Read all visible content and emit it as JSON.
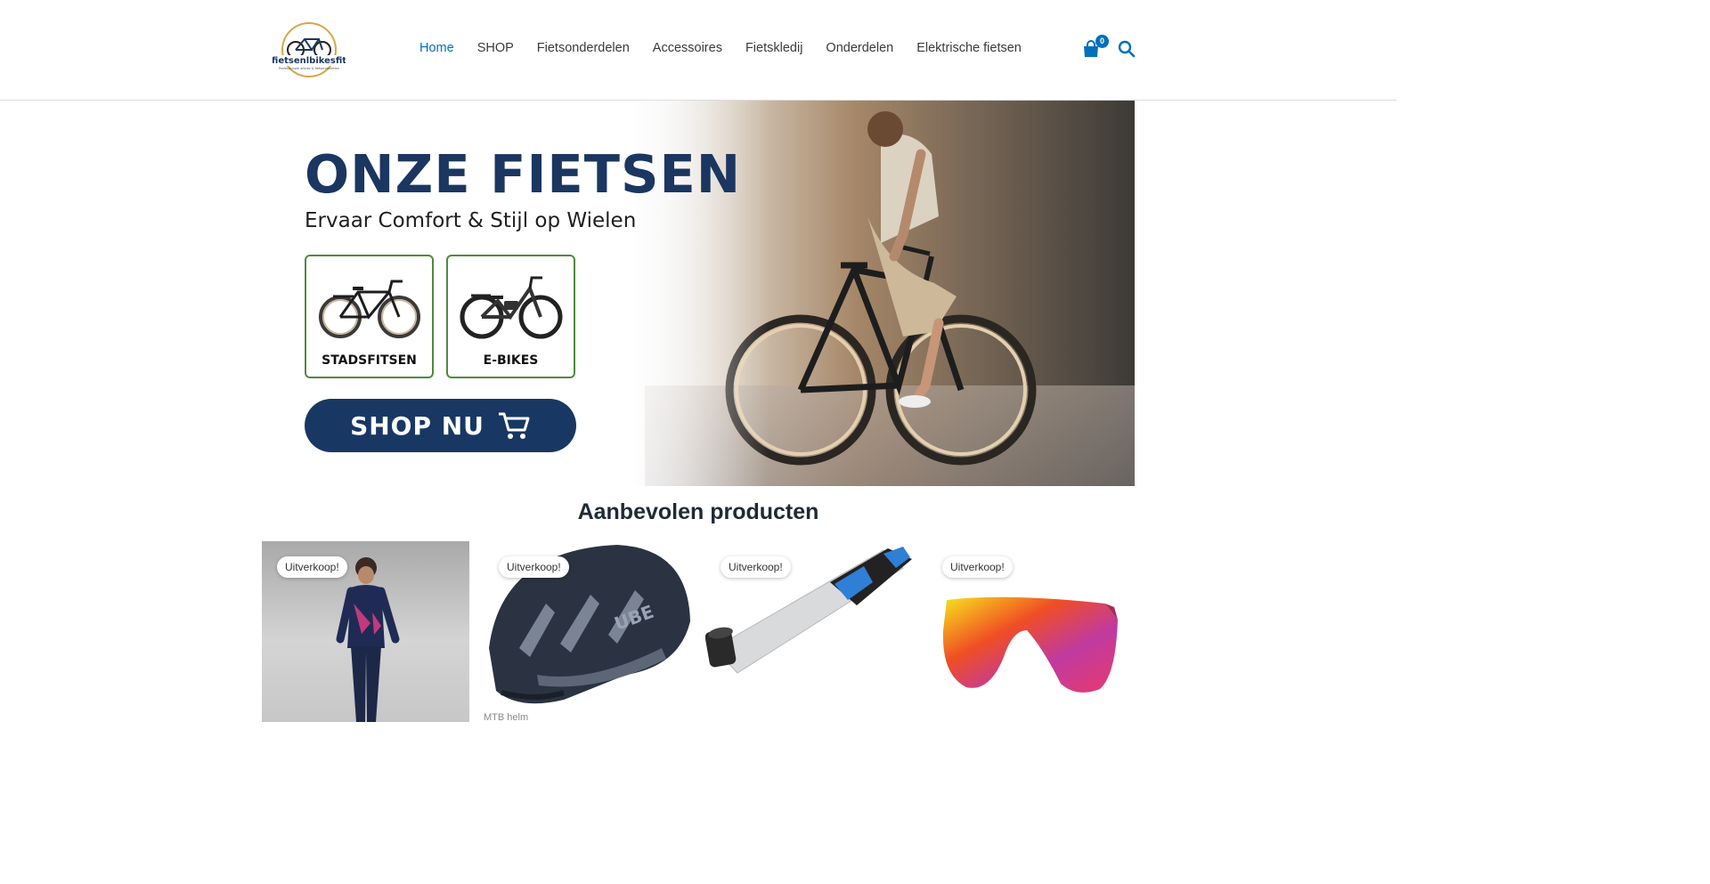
{
  "brand": {
    "logo_text": "fietsenlbikesfit",
    "logo_tagline": "Professioneel advies & fietsonderdelen"
  },
  "nav": {
    "items": [
      {
        "label": "Home",
        "active": true
      },
      {
        "label": "SHOP",
        "active": false
      },
      {
        "label": "Fietsonderdelen",
        "active": false
      },
      {
        "label": "Accessoires",
        "active": false
      },
      {
        "label": "Fietskledij",
        "active": false
      },
      {
        "label": "Onderdelen",
        "active": false
      },
      {
        "label": "Elektrische fietsen",
        "active": false
      }
    ],
    "cart_count": "0",
    "cart_icon": "shopping-bag-icon",
    "search_icon": "search-icon"
  },
  "hero": {
    "title": "ONZE FIETSEN",
    "subtitle": "Ervaar Comfort & Stijl op Wielen",
    "categories": [
      {
        "label": "STADSFITSEN"
      },
      {
        "label": "E-BIKES"
      }
    ],
    "cta_label": "SHOP NU"
  },
  "section": {
    "title": "Aanbevolen producten"
  },
  "products": [
    {
      "badge": "Uitverkoop!",
      "category": ""
    },
    {
      "badge": "Uitverkoop!",
      "category": "MTB helm"
    },
    {
      "badge": "Uitverkoop!",
      "category": ""
    },
    {
      "badge": "Uitverkoop!",
      "category": ""
    }
  ],
  "colors": {
    "accent": "#0170b9",
    "hero_navy": "#183863",
    "category_border": "#4f8a3c"
  }
}
